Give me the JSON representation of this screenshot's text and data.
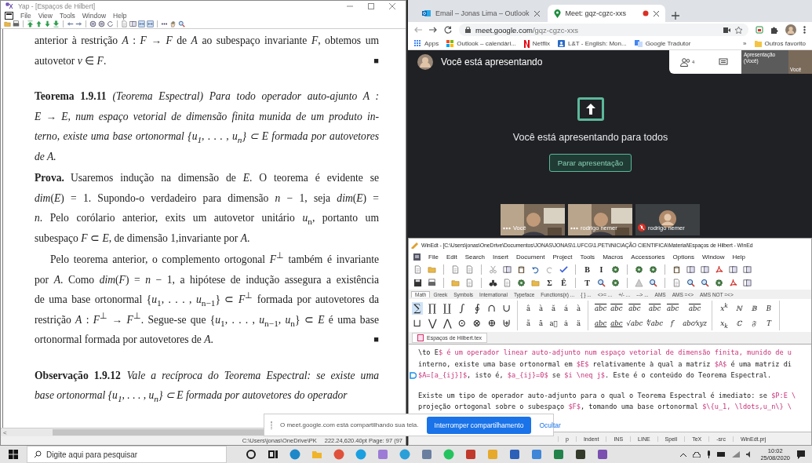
{
  "yap": {
    "title": "Yap - [Espaços de Hilbert]",
    "menu": [
      "File",
      "View",
      "Tools",
      "Window",
      "Help"
    ],
    "toolbar": [
      {
        "kind": "folder"
      },
      {
        "kind": "printer"
      },
      {
        "kind": "sep"
      },
      {
        "kind": "arrow-top"
      },
      {
        "kind": "arrow-up"
      },
      {
        "kind": "arrow-down"
      },
      {
        "kind": "arrow-bottom"
      },
      {
        "kind": "sep"
      },
      {
        "kind": "arrow-left"
      },
      {
        "kind": "arrow-right"
      },
      {
        "kind": "sep"
      },
      {
        "kind": "zoom-in"
      },
      {
        "kind": "zoom-out"
      },
      {
        "kind": "refresh"
      },
      {
        "kind": "sep"
      },
      {
        "kind": "page"
      },
      {
        "kind": "pages"
      },
      {
        "kind": "fit"
      },
      {
        "kind": "fit"
      },
      {
        "kind": "sep"
      },
      {
        "kind": "dots"
      },
      {
        "kind": "hand"
      },
      {
        "kind": "magnifier"
      }
    ],
    "paragraphs": [
      {
        "kind": "text",
        "indent": false,
        "qed": "■",
        "lines": [
          "anterior à restrição *A* : *F* → *F* de *A* ao subespaço invariante *F*, obtemos um",
          "autovetor *v* ∈ *F*."
        ]
      },
      {
        "kind": "theorem",
        "label": "Teorema 1.9.11",
        "indent": false,
        "lines": [
          "(Teorema Espectral) Para todo operador auto-ajunto A :",
          "E → E, num espaço vetorial de dimensão finita munida de um produto in-",
          "terno, existe uma base ortonormal {u$_{1}$, . . . , u$_{n}$} ⊂ E formada por autovetores",
          "de A."
        ]
      },
      {
        "kind": "proof",
        "label": "Prova.",
        "indent": false,
        "lines": [
          "Usaremos indução na dimensão de *E*.  O teorema é evidente se",
          "*dim*(*E*) = 1.  Supondo-o verdadeiro para dimensão *n* − 1, seja *dim*(*E*) =",
          "*n*.  Pelo corólario anterior, exits um autovetor unitário *u*$_{n}$, portanto um",
          "subespaço *F* ⊂ *E*, de dimensão 1,invariante por *A*."
        ]
      },
      {
        "kind": "text",
        "indent": true,
        "qed": "■",
        "lines": [
          "Pelo teorema anterior, o complemento ortogonal *F*$^{⊥}$ também é invariante",
          "por *A*. Como *dim*(*F*) = *n* − 1, a hipótese de indução assegura a existência",
          "de uma base ortonormal {*u*$_{1}$, . . . , *u*$_{n−1}$} ⊂ *F*$^{⊥}$ formada por autovetores da",
          "restrição *A* : *F*$^{⊥}$ → *F*$^{⊥}$. Segue-se que {*u*$_{1}$, . . . , *u*$_{n−1}$, *u*$_{n}$} ⊂ *E* é uma base",
          "ortonormal formada por autovetores de *A*."
        ]
      },
      {
        "kind": "theorem",
        "label": "Observação 1.9.12",
        "indent": false,
        "lines": [
          "Vale a recíproca do Teorema Espectral: se existe uma",
          "base ortonormal {u$_{1}$, . . . , u$_{n}$} ⊂ E formada por autovetores do operador"
        ]
      }
    ],
    "scroll_arrow": "<",
    "status": [
      "C:\\Users\\jonas\\OneDrive\\PK",
      "222.24,620.40pt  Page: 97 (97"
    ]
  },
  "chrome": {
    "tabs": [
      {
        "kind": "outlook",
        "title": "Email – Jonas Lima – Outlook",
        "selected": false,
        "recording": false
      },
      {
        "kind": "meet",
        "title": "Meet: gqz-cgzc-xxs",
        "selected": true,
        "recording": true
      }
    ],
    "url_host": "meet.google.com",
    "url_path": "/gqz-cgzc-xxs",
    "bookmarks": [
      {
        "kind": "apps",
        "title": "Apps"
      },
      {
        "kind": "windows",
        "title": "Outlook – calendári..."
      },
      {
        "kind": "netflix",
        "title": "Netflix"
      },
      {
        "kind": "blue",
        "title": "L&T - English: Mon..."
      },
      {
        "kind": "translate",
        "title": "Google Tradutor"
      }
    ],
    "bookmarks_more": "»",
    "other_bookmarks": "Outros favorito"
  },
  "meet": {
    "header": "Você está apresentando",
    "participants": "4",
    "thumbnails": [
      "Apresentação (Você)",
      "Você"
    ],
    "message": "Você está apresentando para todos",
    "stop_button": "Parar apresentação",
    "tiles": [
      {
        "kind": "video",
        "name": "Você",
        "muted": false
      },
      {
        "kind": "video",
        "name": "rodrigo nemer",
        "muted": false
      },
      {
        "kind": "avatar",
        "name": "rodrigo nemer",
        "muted": true
      }
    ]
  },
  "winedt": {
    "title": "WinEdt - [C:\\Users\\jonas\\OneDrive\\Documentos\\JONAS\\JONAS\\1.UFCG\\1.PET\\INICIAÇÃO CIENTIFICA\\Material\\Espaços de Hilbert - WinEd",
    "menu": [
      "File",
      "Edit",
      "Search",
      "Insert",
      "Document",
      "Project",
      "Tools",
      "Macros",
      "Accessories",
      "Options",
      "Window",
      "Help"
    ],
    "toolbar_rows": [
      [
        {
          "kind": "page"
        },
        {
          "kind": "folder"
        },
        {
          "kind": "sep"
        },
        {
          "kind": "page"
        },
        {
          "kind": "page"
        },
        {
          "kind": "sep"
        },
        {
          "kind": "scissors"
        },
        {
          "kind": "pages"
        },
        {
          "kind": "clipboard"
        },
        {
          "kind": "undo"
        },
        {
          "kind": "redo"
        },
        {
          "kind": "check"
        },
        {
          "kind": "sep"
        },
        {
          "kind": "letter",
          "text": "B"
        },
        {
          "kind": "letter",
          "text": "I"
        },
        {
          "kind": "gear"
        },
        {
          "kind": "sep"
        },
        {
          "kind": "gear"
        },
        {
          "kind": "gear"
        },
        {
          "kind": "sep"
        },
        {
          "kind": "clipboard"
        },
        {
          "kind": "pages"
        },
        {
          "kind": "pages"
        },
        {
          "kind": "acrobat"
        },
        {
          "kind": "pages"
        },
        {
          "kind": "pages"
        }
      ],
      [
        {
          "kind": "disk"
        },
        {
          "kind": "printer"
        },
        {
          "kind": "sep"
        },
        {
          "kind": "folder"
        },
        {
          "kind": "page"
        },
        {
          "kind": "sep"
        },
        {
          "kind": "binoculars"
        },
        {
          "kind": "page"
        },
        {
          "kind": "gear"
        },
        {
          "kind": "folder"
        },
        {
          "kind": "letter",
          "text": "Σ"
        },
        {
          "kind": "letter",
          "text": "Ê"
        },
        {
          "kind": "sep"
        },
        {
          "kind": "letter",
          "text": "T"
        },
        {
          "kind": "magnifier"
        },
        {
          "kind": "gear"
        },
        {
          "kind": "sep"
        },
        {
          "kind": "warning"
        },
        {
          "kind": "magnifier"
        },
        {
          "kind": "sep"
        },
        {
          "kind": "page"
        },
        {
          "kind": "magnifier"
        },
        {
          "kind": "magnifier"
        },
        {
          "kind": "gear"
        },
        {
          "kind": "acrobat"
        },
        {
          "kind": "pages"
        }
      ]
    ],
    "palette_tabs": [
      {
        "label": "Math",
        "selected": true
      },
      {
        "label": "Greek",
        "selected": false
      },
      {
        "label": "Symbols",
        "selected": false
      },
      {
        "label": "International",
        "selected": false
      },
      {
        "label": "Typeface",
        "selected": false
      },
      {
        "label": "Functions(x) ...",
        "selected": false
      },
      {
        "label": "{ } ...",
        "selected": false
      },
      {
        "label": "<>= ...",
        "selected": false
      },
      {
        "label": "+/- ...",
        "selected": false
      },
      {
        "label": "--> ...",
        "selected": false
      },
      {
        "label": "AMS",
        "selected": false
      },
      {
        "label": "AMS =<>",
        "selected": false
      },
      {
        "label": "AMS NOT =<>",
        "selected": false
      }
    ],
    "palette_groups": [
      [
        {
          "kind": "big",
          "text": "∑",
          "selected": true
        },
        {
          "kind": "big",
          "text": "∏",
          "selected": false
        },
        {
          "kind": "big",
          "text": "∐",
          "selected": false
        },
        {
          "kind": "big",
          "text": "∫",
          "selected": false
        },
        {
          "kind": "big",
          "text": "∮",
          "selected": false
        },
        {
          "kind": "big",
          "text": "∩",
          "selected": false
        },
        {
          "kind": "big",
          "text": "∪",
          "selected": false
        },
        {
          "kind": "big",
          "text": "⊔",
          "selected": false
        },
        {
          "kind": "big",
          "text": "⋁",
          "selected": false
        },
        {
          "kind": "big",
          "text": "⋀",
          "selected": false
        },
        {
          "kind": "big",
          "text": "⊙",
          "selected": false
        },
        {
          "kind": "big",
          "text": "⊗",
          "selected": false
        },
        {
          "kind": "big",
          "text": "⊕",
          "selected": false
        },
        {
          "kind": "big",
          "text": "⊎",
          "selected": false
        }
      ],
      [
        {
          "kind": "small",
          "text": "â",
          "selected": false
        },
        {
          "kind": "small",
          "text": "à",
          "selected": false
        },
        {
          "kind": "small",
          "text": "ă",
          "selected": false
        },
        {
          "kind": "small",
          "text": "á",
          "selected": false
        },
        {
          "kind": "small",
          "text": "à",
          "selected": false
        },
        {
          "kind": "small",
          "text": "ã",
          "selected": false
        },
        {
          "kind": "small",
          "text": "ā",
          "selected": false
        },
        {
          "kind": "small",
          "text": "a⃗",
          "selected": false
        },
        {
          "kind": "small",
          "text": "ȧ",
          "selected": false
        },
        {
          "kind": "small",
          "text": "ä",
          "selected": false
        }
      ],
      [
        {
          "kind": "over",
          "text": "abc",
          "selected": false
        },
        {
          "kind": "over",
          "text": "abc",
          "selected": false
        },
        {
          "kind": "over",
          "text": "abc",
          "selected": false
        },
        {
          "kind": "over",
          "text": "abc",
          "selected": false
        },
        {
          "kind": "over",
          "text": "abc",
          "selected": false
        },
        {
          "kind": "over",
          "text": "abc",
          "selected": false
        },
        {
          "kind": "under",
          "text": "abc",
          "selected": false
        },
        {
          "kind": "under",
          "text": "abc",
          "selected": false
        },
        {
          "kind": "plain",
          "text": "√abc",
          "selected": false
        },
        {
          "kind": "plain",
          "text": "∜abc",
          "selected": false
        },
        {
          "kind": "plain",
          "text": "f′",
          "selected": false
        },
        {
          "kind": "plain",
          "text": "abc⁄xyz",
          "selected": false
        }
      ],
      [
        {
          "kind": "rich",
          "text": "x$^{k}$",
          "selected": false
        },
        {
          "kind": "plain",
          "text": "ℕ",
          "selected": false
        },
        {
          "kind": "plain",
          "text": "𝔹",
          "selected": false
        },
        {
          "kind": "plain",
          "text": "B",
          "selected": false
        },
        {
          "kind": "rich",
          "text": "x$_{k}$",
          "selected": false
        },
        {
          "kind": "plain",
          "text": "ℂ",
          "selected": false
        },
        {
          "kind": "plain",
          "text": "𝔉",
          "selected": false
        },
        {
          "kind": "plain",
          "text": "T",
          "selected": false
        }
      ]
    ],
    "file_tab": "Espaços de Hilbert.tex",
    "editor": [
      [
        {
          "text": "\\to E$ é um operador linear auto-adjunto num espaço vetorial de dimensão finita, munido de u",
          "current": false
        },
        {
          "text": "interno, existe uma base ortonormal em $E$ relativamente à qual a matriz $A$ é uma matriz di",
          "current": false
        },
        {
          "text": "$A=[a_{ij}]$, isto é, $a_{ij}=0$ se $i \\neq j$. Este é o conteúdo do Teorema Espectral.",
          "current": true
        }
      ],
      [
        {
          "text": "Existe um tipo de operador auto-adjunto para o qual o Teorema Espectral é imediato: se $P:E \\",
          "current": false
        },
        {
          "text": "projeção ortogonal sobre o subespaço $F$, tomando uma base ortonormal $\\{u_1, \\ldots,u_n\\} \\",
          "current": false
        }
      ]
    ],
    "status": [
      "p",
      "Indent",
      "INS",
      "LINE",
      "Spell",
      "TeX",
      "-src",
      "WinEdt.prj"
    ]
  },
  "share_bar": {
    "message": "O meet.google.com está compartilhando sua tela.",
    "stop_button": "Interromper compartilhamento",
    "hide_link": "Ocultar"
  },
  "taskbar": {
    "search_placeholder": "Digite aqui para pesquisar",
    "apps": [
      {
        "kind": "ring",
        "color": "#1a1a1a"
      },
      {
        "kind": "taskview",
        "color": "#1a1a1a"
      },
      {
        "kind": "circle",
        "color": "#1e88c8"
      },
      {
        "kind": "folder",
        "color": "#f0b429"
      },
      {
        "kind": "circle",
        "color": "#e0513b"
      },
      {
        "kind": "circle",
        "color": "#1a9fe0"
      },
      {
        "kind": "square",
        "color": "#9c7bd6"
      },
      {
        "kind": "circle",
        "color": "#2a9fd8"
      },
      {
        "kind": "square",
        "color": "#6a7fa0"
      },
      {
        "kind": "circle",
        "color": "#25c35f"
      },
      {
        "kind": "square",
        "color": "#c0392b"
      },
      {
        "kind": "square",
        "color": "#e7a92c"
      },
      {
        "kind": "square",
        "color": "#2b5fb8"
      },
      {
        "kind": "square",
        "color": "#3f86d8"
      },
      {
        "kind": "square",
        "color": "#21824a"
      },
      {
        "kind": "square",
        "color": "#333a2a"
      },
      {
        "kind": "square",
        "color": "#7a4fb0"
      }
    ],
    "time": "10:02",
    "date": "25/08/2020"
  }
}
